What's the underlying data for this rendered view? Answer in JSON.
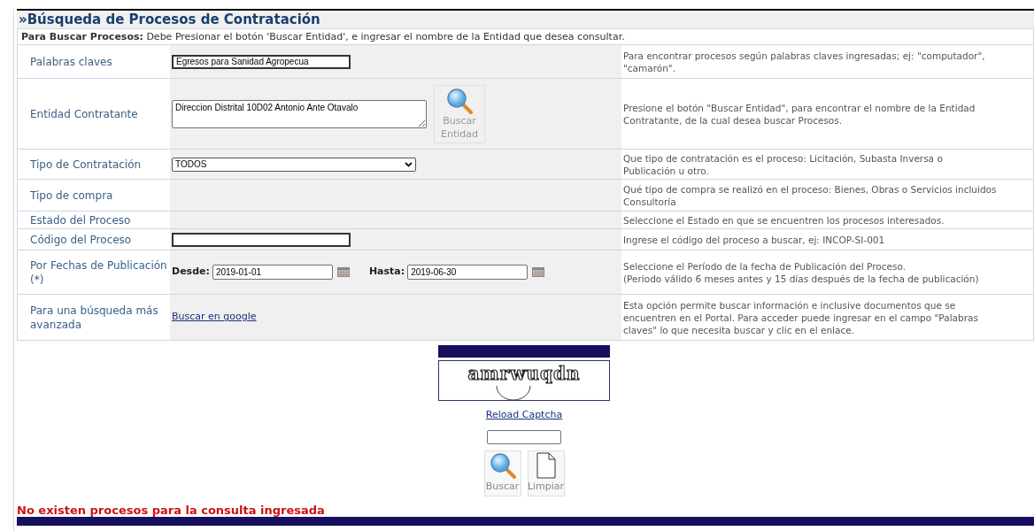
{
  "title": "»Búsqueda de Procesos de Contratación",
  "instructions": "**Para Buscar Procesos:** Debe Presionar el botón 'Buscar Entidad', e ingresar el nombre de la Entidad que desea consultar.",
  "rows": [
    {
      "kind": "text",
      "label": "Palabras claves",
      "value": "Egresos para Sanidad Agropecua",
      "help": "Para encontrar procesos según palabras claves ingresadas; ej: \"computador\", \"camarón\"."
    },
    {
      "kind": "entity",
      "label": "Entidad Contratante",
      "value": "Direccion Distrital 10D02 Antonio Ante Otavalo",
      "button": "Buscar Entidad",
      "help": "Presione el botón \"Buscar Entidad\", para encontrar el nombre de la Entidad Contratante, de la cual desea buscar Procesos."
    },
    {
      "kind": "select",
      "label": "Tipo de Contratación",
      "value": "TODOS",
      "help": "Que tipo de contratación es el proceso: Licitación, Subasta Inversa o Publicación u otro."
    },
    {
      "kind": "empty",
      "label": "Tipo de compra",
      "help": "Qué tipo de compra se realizó en el proceso: Bienes, Obras o Servicios incluidos Consultoría"
    },
    {
      "kind": "empty",
      "label": "Estado del Proceso",
      "help": "Seleccione el Estado en que se encuentren los procesos interesados."
    },
    {
      "kind": "text",
      "label": "Código del Proceso",
      "help": "Ingrese el código del proceso a buscar, ej: INCOP-SI-001"
    },
    {
      "kind": "dates",
      "label": "Por Fechas de Publicación (*)",
      "from_label": "Desde:",
      "from": "2019-01-01",
      "to_label": "Hasta:",
      "to": "2019-06-30",
      "help": "Seleccione el Período de la fecha de Publicación del Proceso.\n(Periodo válido 6 meses antes y 15 días después de la fecha de publicación)"
    },
    {
      "kind": "link",
      "label": "Para una búsqueda más avanzada",
      "link": "Buscar en google",
      "help": "Esta opción permite buscar información e inclusive documentos que se encuentren en el Portal. Para acceder puede ingresar en el campo \"Palabras claves\" lo que necesita buscar y clic en el enlace."
    }
  ],
  "captcha": {
    "text": "amrwuqdn",
    "reload": "Reload Captcha"
  },
  "buttons": [
    {
      "kind": "search",
      "label": "Buscar"
    },
    {
      "kind": "clear",
      "label": "Limpiar"
    }
  ],
  "error": "No existen procesos para la consulta ingresada"
}
